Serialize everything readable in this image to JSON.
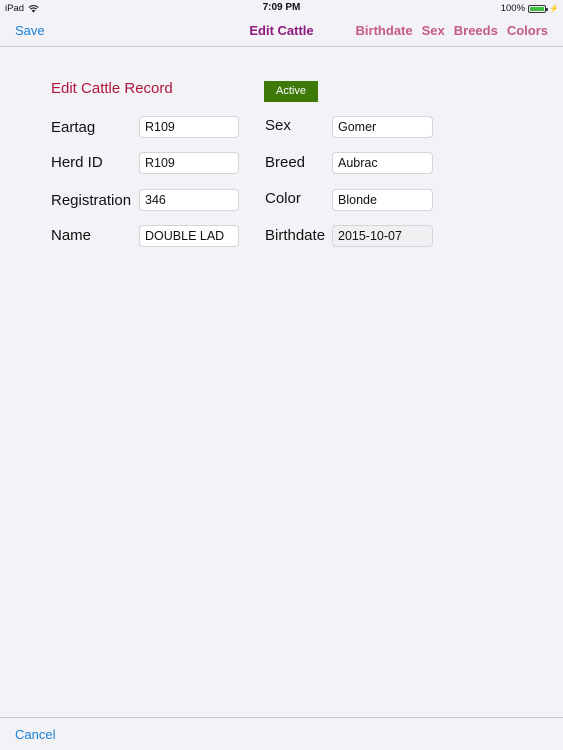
{
  "status_bar": {
    "device": "iPad",
    "time": "7:09 PM",
    "battery_percent": "100%",
    "battery_level": 1.0
  },
  "nav": {
    "save_label": "Save",
    "title": "Edit Cattle",
    "links": [
      "Birthdate",
      "Sex",
      "Breeds",
      "Colors"
    ]
  },
  "form": {
    "title": "Edit Cattle Record",
    "status_badge": "Active",
    "eartag": {
      "label": "Eartag",
      "value": "R109"
    },
    "herd_id": {
      "label": "Herd ID",
      "value": "R109"
    },
    "registration": {
      "label": "Registration",
      "value": "346"
    },
    "name": {
      "label": "Name",
      "value": "DOUBLE LAD"
    },
    "sex": {
      "label": "Sex",
      "value": "Gomer"
    },
    "breed": {
      "label": "Breed",
      "value": "Aubrac"
    },
    "color": {
      "label": "Color",
      "value": "Blonde"
    },
    "birthdate": {
      "label": "Birthdate",
      "value": "2015-10-07"
    }
  },
  "toolbar": {
    "cancel_label": "Cancel"
  },
  "colors": {
    "link_blue": "#1a7fd6",
    "title_purple": "#8e1a80",
    "nav_pink": "#c65a88",
    "form_title_red": "#b0163c",
    "active_green": "#3d7a0a"
  }
}
